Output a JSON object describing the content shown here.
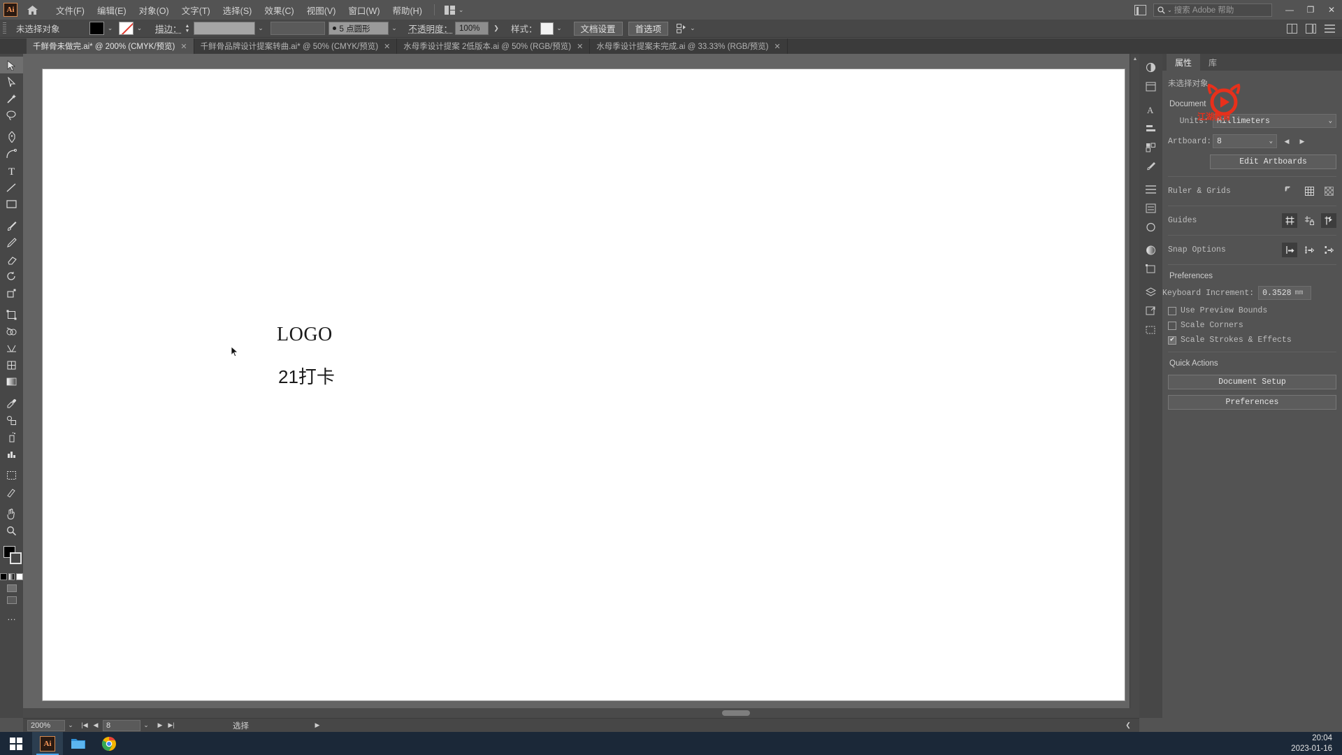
{
  "app": {
    "name": "Adobe Illustrator",
    "logo_text": "Ai"
  },
  "menubar": {
    "home_icon": "home-icon",
    "items": [
      {
        "label": "文件(F)"
      },
      {
        "label": "编辑(E)"
      },
      {
        "label": "对象(O)"
      },
      {
        "label": "文字(T)"
      },
      {
        "label": "选择(S)"
      },
      {
        "label": "效果(C)"
      },
      {
        "label": "视图(V)"
      },
      {
        "label": "窗口(W)"
      },
      {
        "label": "帮助(H)"
      }
    ],
    "workspace_chevron": "⌄",
    "search_placeholder": "搜索 Adobe 帮助",
    "search_chevron": "⌄",
    "window_buttons": {
      "minimize": "—",
      "restore": "❐",
      "close": "✕"
    }
  },
  "controlbar": {
    "selection_status": "未选择对象",
    "fill_swatch_color": "#000000",
    "stroke_swatch": "none",
    "chevron": "⌄",
    "stroke_label": "描边：",
    "stroke_weight_value": "5 点圆形",
    "stroke_weight_dot": "●",
    "opacity_label": "不透明度：",
    "opacity_value": "100%",
    "opacity_arrow": "❯",
    "style_label": "样式：",
    "style_swatch_color": "#f2f2f2",
    "document_setup_button": "文档设置",
    "preferences_button": "首选项",
    "align_chevron": "⌄"
  },
  "tabs": [
    {
      "label": "千鲜骨未做完.ai* @ 200% (CMYK/预览)",
      "close": "✕",
      "active": true
    },
    {
      "label": "千鲜骨品牌设计提案转曲.ai* @ 50% (CMYK/预览)",
      "close": "✕",
      "active": false
    },
    {
      "label": "水母季设计提案 2低版本.ai @ 50% (RGB/预览)",
      "close": "✕",
      "active": false
    },
    {
      "label": "水母季设计提案未完成.ai @ 33.33% (RGB/预览)",
      "close": "✕",
      "active": false
    }
  ],
  "toolbar": {
    "tools": [
      {
        "name": "selection-tool",
        "icon": "cursor-arrow"
      },
      {
        "name": "direct-selection-tool",
        "icon": "cursor-white-arrow"
      },
      {
        "name": "magic-wand-tool",
        "icon": "magic-wand"
      },
      {
        "name": "lasso-tool",
        "icon": "lasso"
      },
      {
        "name": "pen-tool",
        "icon": "pen"
      },
      {
        "name": "curvature-tool",
        "icon": "curvature"
      },
      {
        "name": "type-tool",
        "icon": "letter-T"
      },
      {
        "name": "line-segment-tool",
        "icon": "line"
      },
      {
        "name": "rectangle-tool",
        "icon": "rectangle"
      },
      {
        "name": "paintbrush-tool",
        "icon": "paintbrush"
      },
      {
        "name": "shaper-tool",
        "icon": "shaper-pencil"
      },
      {
        "name": "eraser-tool",
        "icon": "eraser"
      },
      {
        "name": "rotate-tool",
        "icon": "rotate"
      },
      {
        "name": "scale-tool",
        "icon": "scale"
      },
      {
        "name": "free-transform-tool",
        "icon": "free-transform"
      },
      {
        "name": "shape-builder-tool",
        "icon": "shape-builder"
      },
      {
        "name": "perspective-grid-tool",
        "icon": "perspective-grid"
      },
      {
        "name": "mesh-tool",
        "icon": "mesh"
      },
      {
        "name": "gradient-tool",
        "icon": "gradient"
      },
      {
        "name": "eyedropper-tool",
        "icon": "eyedropper"
      },
      {
        "name": "blend-tool",
        "icon": "blend"
      },
      {
        "name": "symbol-sprayer-tool",
        "icon": "symbol-sprayer"
      },
      {
        "name": "column-graph-tool",
        "icon": "bar-chart"
      },
      {
        "name": "artboard-tool",
        "icon": "artboard"
      },
      {
        "name": "slice-tool",
        "icon": "slice"
      },
      {
        "name": "hand-tool",
        "icon": "hand"
      },
      {
        "name": "zoom-tool",
        "icon": "magnifier"
      }
    ],
    "more_tools": "…",
    "fill_color": "#000000",
    "stroke_color": "#ffffff"
  },
  "canvas": {
    "artwork": {
      "logo_text": "LOGO",
      "sub_text": "21打卡"
    },
    "cursor_icon": "mouse-pointer"
  },
  "properties_panel": {
    "tabs": [
      {
        "label": "属性",
        "active": true
      },
      {
        "label": "库",
        "active": false
      }
    ],
    "selection_title": "未选择对象",
    "document_section": "Document",
    "units_label": "Units:",
    "units_value": "Millimeters",
    "artboard_label": "Artboard:",
    "artboard_value": "8",
    "edit_artboards_button": "Edit Artboards",
    "ruler_grids_label": "Ruler & Grids",
    "ruler_buttons": [
      "show-rulers-icon",
      "show-grid-icon",
      "show-transparency-grid-icon"
    ],
    "guides_label": "Guides",
    "guides_buttons": [
      "show-guides-icon",
      "lock-guides-icon",
      "smart-guides-icon"
    ],
    "snap_options_label": "Snap Options",
    "snap_buttons": [
      "snap-to-point-icon",
      "snap-to-grid-icon",
      "snap-to-pixel-icon"
    ],
    "preferences_label": "Preferences",
    "keyboard_increment_label": "Keyboard Increment:",
    "keyboard_increment_value": "0.3528",
    "keyboard_increment_unit": "mm",
    "checkboxes": [
      {
        "label": "Use Preview Bounds",
        "checked": false
      },
      {
        "label": "Scale Corners",
        "checked": false
      },
      {
        "label": "Scale Strokes & Effects",
        "checked": true
      }
    ],
    "quick_actions_label": "Quick Actions",
    "quick_actions": [
      {
        "label": "Document Setup"
      },
      {
        "label": "Preferences"
      }
    ],
    "watermark_text": "江湖教育",
    "watermark_color": "#e8301b",
    "chevron": "⌄",
    "prev_arrow": "◀",
    "next_arrow": "▶",
    "check_mark": "✔"
  },
  "icon_rail": {
    "buttons": [
      "color-panel-icon",
      "properties-panel-icon",
      "character-panel-icon",
      "align-panel-icon",
      "swatches-panel-icon",
      "brushes-panel-icon",
      "symbols-panel-icon",
      "transparency-panel-icon",
      "appearance-panel-icon",
      "gradient-panel-icon",
      "transform-panel-icon",
      "layers-panel-icon",
      "artboards-panel-icon",
      "asset-export-panel-icon"
    ]
  },
  "statusbar": {
    "zoom_value": "200%",
    "zoom_chevron": "⌄",
    "first_artboard": "|◀",
    "prev_artboard": "◀",
    "artboard_number": "8",
    "artboard_chevron": "⌄",
    "next_artboard": "▶",
    "last_artboard": "▶|",
    "status_text": "选择",
    "status_arrow": "▶",
    "left_arrow": "❮"
  },
  "taskbar": {
    "start_icon": "windows-start-icon",
    "apps": [
      {
        "name": "illustrator",
        "label": "Ai",
        "active": true
      },
      {
        "name": "file-explorer",
        "label": "",
        "active": false
      },
      {
        "name": "chrome",
        "label": "",
        "active": false
      }
    ],
    "time": "20:04",
    "date": "2023-01-16"
  }
}
